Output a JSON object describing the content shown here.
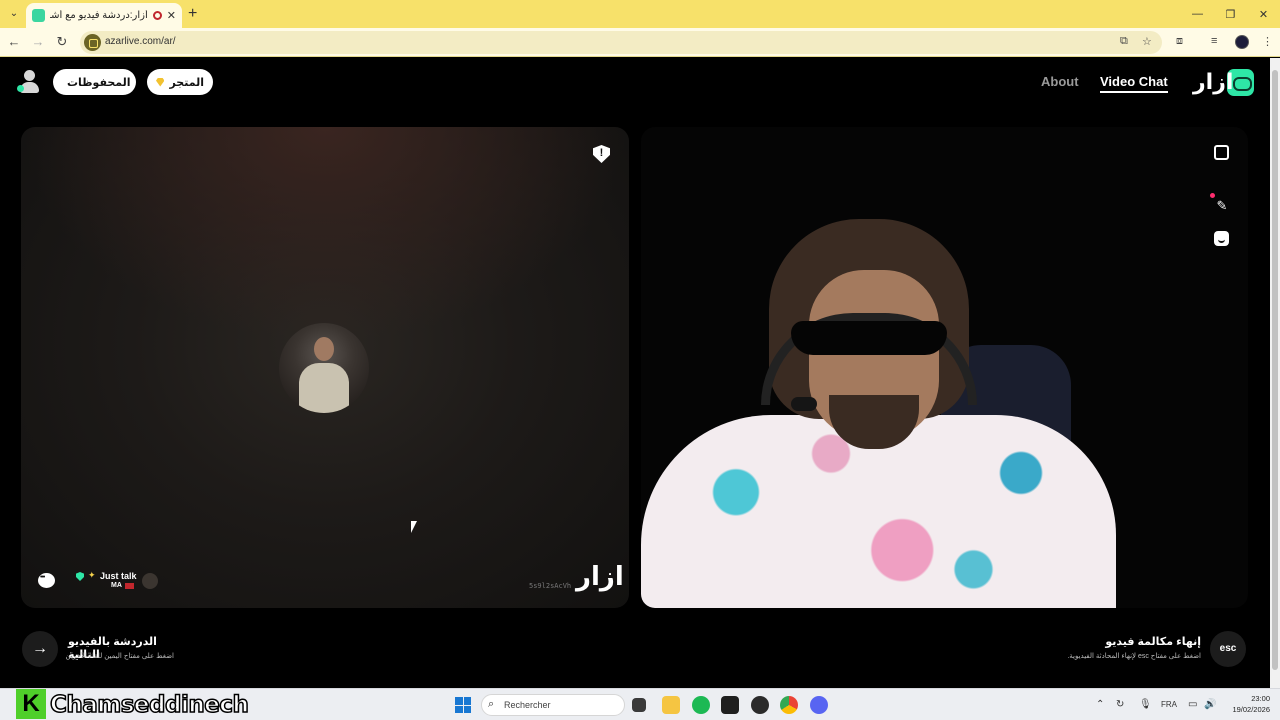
{
  "browser": {
    "tab_title": "أزار:دردشة فيديو مع أشخاص",
    "url": "azarlive.com/ar/",
    "new_tab_symbol": "+",
    "tab_close_symbol": "✕"
  },
  "header": {
    "logo_text": "ازار",
    "nav_video_chat": "Video Chat",
    "nav_about": "About",
    "store_label": "المتجر",
    "saved_label": "المحفوظات"
  },
  "partner_panel": {
    "badge_label": "Just talk",
    "badge_country": "MA",
    "session_id": "5s9l2sAcVh",
    "watermark": "ازار",
    "report_symbol": "!"
  },
  "controls": {
    "next_title": "الدردشة بالفيديو التالية",
    "next_subtitle": "اضغط على مفتاح اليمين للقاء الآخرين",
    "next_symbol": "→",
    "end_title": "إنهاء مكالمة فيديو",
    "end_subtitle": "اضغط على مفتاح esc لإنهاء المحادثة الفيديوية.",
    "esc_label": "esc"
  },
  "overlay": {
    "streamer_initial": "K",
    "streamer_name": "Chamseddinech"
  },
  "taskbar": {
    "search_placeholder": "Rechercher",
    "language": "FRA",
    "time": "23:00",
    "date": "19/02/2026"
  },
  "icons": {
    "back": "back-arrow-icon",
    "forward": "forward-arrow-icon",
    "reload": "reload-icon",
    "report": "report-shield-icon",
    "expand": "expand-icon",
    "magic": "magic-wand-icon",
    "emoji": "emoji-icon",
    "chat": "chat-bubble-icon"
  },
  "colors": {
    "brand_accent": "#2ee6a6",
    "chrome_tab_bar": "#f7e16a",
    "store_gem": "#f2c230",
    "page_background": "#000000"
  }
}
